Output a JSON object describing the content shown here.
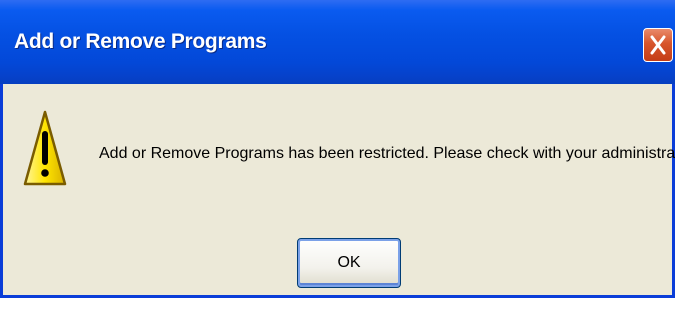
{
  "dialog": {
    "title": "Add or Remove Programs",
    "message": "Add or Remove Programs has been restricted. Please check with your administrator.",
    "icon": "warning-icon",
    "ok_label": "OK"
  },
  "colors": {
    "titlebar": "#0551E3",
    "window_background": "#ECE9D8",
    "close_button": "#D7552C",
    "warning_icon": "#FFE500"
  }
}
